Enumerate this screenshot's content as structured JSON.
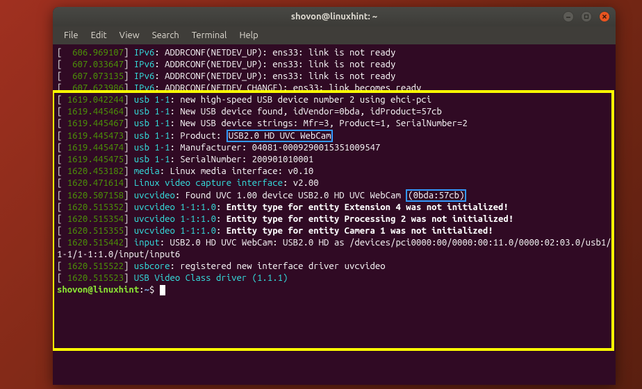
{
  "window": {
    "title": "shovon@linuxhint: ~"
  },
  "menu": [
    "File",
    "Edit",
    "View",
    "Search",
    "Terminal",
    "Help"
  ],
  "lines": {
    "l1_ts": "  606.969107",
    "l1_kw": "IPv6",
    "l1_txt": ": ADDRCONF(NETDEV_UP): ens33: link is not ready",
    "l2_ts": "  607.033647",
    "l2_kw": "IPv6",
    "l2_txt": ": ADDRCONF(NETDEV_UP): ens33: link is not ready",
    "l3_ts": "  607.073135",
    "l3_kw": "IPv6",
    "l3_txt": ": ADDRCONF(NETDEV_UP): ens33: link is not ready",
    "l4_ts": "  607.623986",
    "l4_kw": "IPv6",
    "l4_txt": ": ADDRCONF(NETDEV_CHANGE): ens33: link becomes ready",
    "l5_ts": " 1619.042244",
    "l5_kw": "usb 1-1",
    "l5_txt": ": new high-speed USB device number 2 using ehci-pci",
    "l6_ts": " 1619.445464",
    "l6_kw": "usb 1-1",
    "l6_txt": ": New USB device found, idVendor=0bda, idProduct=57cb",
    "l7_ts": " 1619.445467",
    "l7_kw": "usb 1-1",
    "l7_txt": ": New USB device strings: Mfr=3, Product=1, SerialNumber=2",
    "l8_ts": " 1619.445473",
    "l8_kw": "usb 1-1",
    "l8_txt_a": ": Product: ",
    "l8_box": "USB2.0 HD UVC WebCam",
    "l9_ts": " 1619.445474",
    "l9_kw": "usb 1-1",
    "l9_txt": ": Manufacturer: 04081-0009290015351009547",
    "l10_ts": " 1619.445475",
    "l10_kw": "usb 1-1",
    "l10_txt": ": SerialNumber: 200901010001",
    "l11_ts": " 1620.453182",
    "l11_kw": "media",
    "l11_txt": ": Linux media interface: v0.10",
    "l12_ts": " 1620.471614",
    "l12_kw": "Linux video capture interface",
    "l12_txt": ": v2.00",
    "l13_ts": " 1620.507158",
    "l13_kw": "uvcvideo",
    "l13_txt_a": ": Found UVC 1.00 device USB2.0 HD UVC WebCam ",
    "l13_box": "(0bda:57cb)",
    "l14_ts": " 1620.515352",
    "l14_kw": "uvcvideo 1-1:1.0",
    "l14_txt": "Entity type for entity Extension 4 was not initialized!",
    "l15_ts": " 1620.515354",
    "l15_kw": "uvcvideo 1-1:1.0",
    "l15_txt": "Entity type for entity Processing 2 was not initialized!",
    "l16_ts": " 1620.515355",
    "l16_kw": "uvcvideo 1-1:1.0",
    "l16_txt": "Entity type for entity Camera 1 was not initialized!",
    "l17_ts": " 1620.515442",
    "l17_kw": "input",
    "l17_txt": ": USB2.0 HD UVC WebCam: USB2.0 HD as /devices/pci0000:00/0000:00:11.0/0000:02:03.0/usb1/1-1/1-1:1.0/input/input6",
    "l18_ts": " 1620.515522",
    "l18_kw": "usbcore",
    "l18_txt": ": registered new interface driver uvcvideo",
    "l19_ts": " 1620.515523",
    "l19_kw": "USB Video Class driver (1.1.1)"
  },
  "prompt": {
    "user": "shovon@linuxhint",
    "colon": ":",
    "path": "~",
    "sym": "$"
  }
}
